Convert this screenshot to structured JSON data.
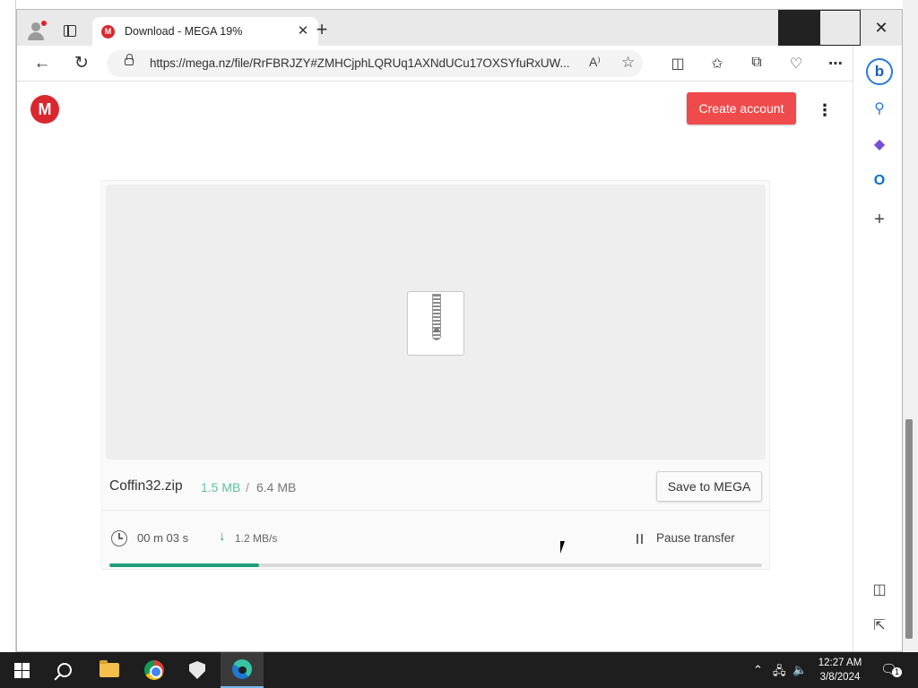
{
  "browser": {
    "tab": {
      "title": "Download - MEGA 19%",
      "favicon": "M",
      "close": "✕"
    },
    "new_tab": "+",
    "address": {
      "url": "https://mega.nz/file/RrFBRJZY#ZMHCjphLQRUq1AXNdUCu17OXSYfuRxUW...",
      "read_aloud": "A⁾"
    },
    "window_controls": {
      "close": "✕"
    }
  },
  "page": {
    "logo": "M",
    "create_account": "Create account",
    "file": {
      "name": "Coffin32.zip",
      "downloaded": "1.5 MB",
      "separator": "/",
      "total": "6.4 MB",
      "save_button": "Save to MEGA"
    },
    "transfer": {
      "elapsed": "00 m  03 s",
      "speed": "1.2 MB/s",
      "pause_label": "Pause transfer",
      "progress_fraction": 0.23
    }
  },
  "taskbar": {
    "clock_time": "12:27 AM",
    "clock_date": "3/8/2024",
    "notification_count": "1"
  },
  "colors": {
    "mega_red": "#d9272e",
    "create_button": "#f04b4c",
    "progress": "#1f9e7a",
    "downloaded_text": "#5ec2a2"
  },
  "icons": {
    "profile": "profile-icon",
    "tab_actions": "tab-actions-icon",
    "back": "back-arrow-icon",
    "refresh": "refresh-icon",
    "lock": "lock-icon",
    "favorite": "star-icon",
    "split_screen": "split-screen-icon",
    "favorites": "favorites-icon",
    "collections": "collections-icon",
    "performance": "heartbeat-icon",
    "more": "more-icon",
    "zip_file": "zip-file-icon",
    "clock": "clock-icon",
    "download_speed": "down-arrow-icon",
    "pause": "pause-icon"
  }
}
